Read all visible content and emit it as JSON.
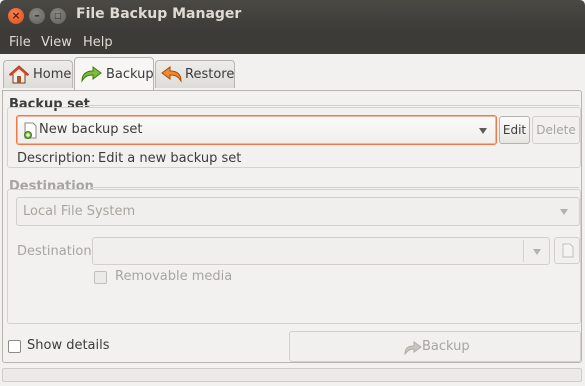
{
  "window": {
    "title": "File Backup Manager",
    "controls": {
      "close": "×",
      "minimize": "–",
      "maximize": "□"
    }
  },
  "menubar": {
    "items": [
      "File",
      "View",
      "Help"
    ]
  },
  "tabs": [
    {
      "label": "Home",
      "icon": "home-icon",
      "active": false
    },
    {
      "label": "Backup",
      "icon": "backup-arrow-icon",
      "active": true
    },
    {
      "label": "Restore",
      "icon": "restore-arrow-icon",
      "active": false
    }
  ],
  "backup_set": {
    "section_title": "Backup set",
    "selected": "New backup set",
    "edit_label": "Edit",
    "delete_label": "Delete",
    "description_label": "Description:",
    "description_value": "Edit a new backup set"
  },
  "destination": {
    "section_title": "Destination",
    "type_selected": "Local File System",
    "field_label": "Destination:",
    "field_value": "",
    "removable_media_label": "Removable media",
    "removable_media_checked": false
  },
  "footer": {
    "show_details_label": "Show details",
    "show_details_checked": false,
    "backup_button_label": "Backup"
  },
  "colors": {
    "accent": "#f0784a",
    "titlebar": "#3c3b37",
    "close_button": "#df4a16"
  }
}
